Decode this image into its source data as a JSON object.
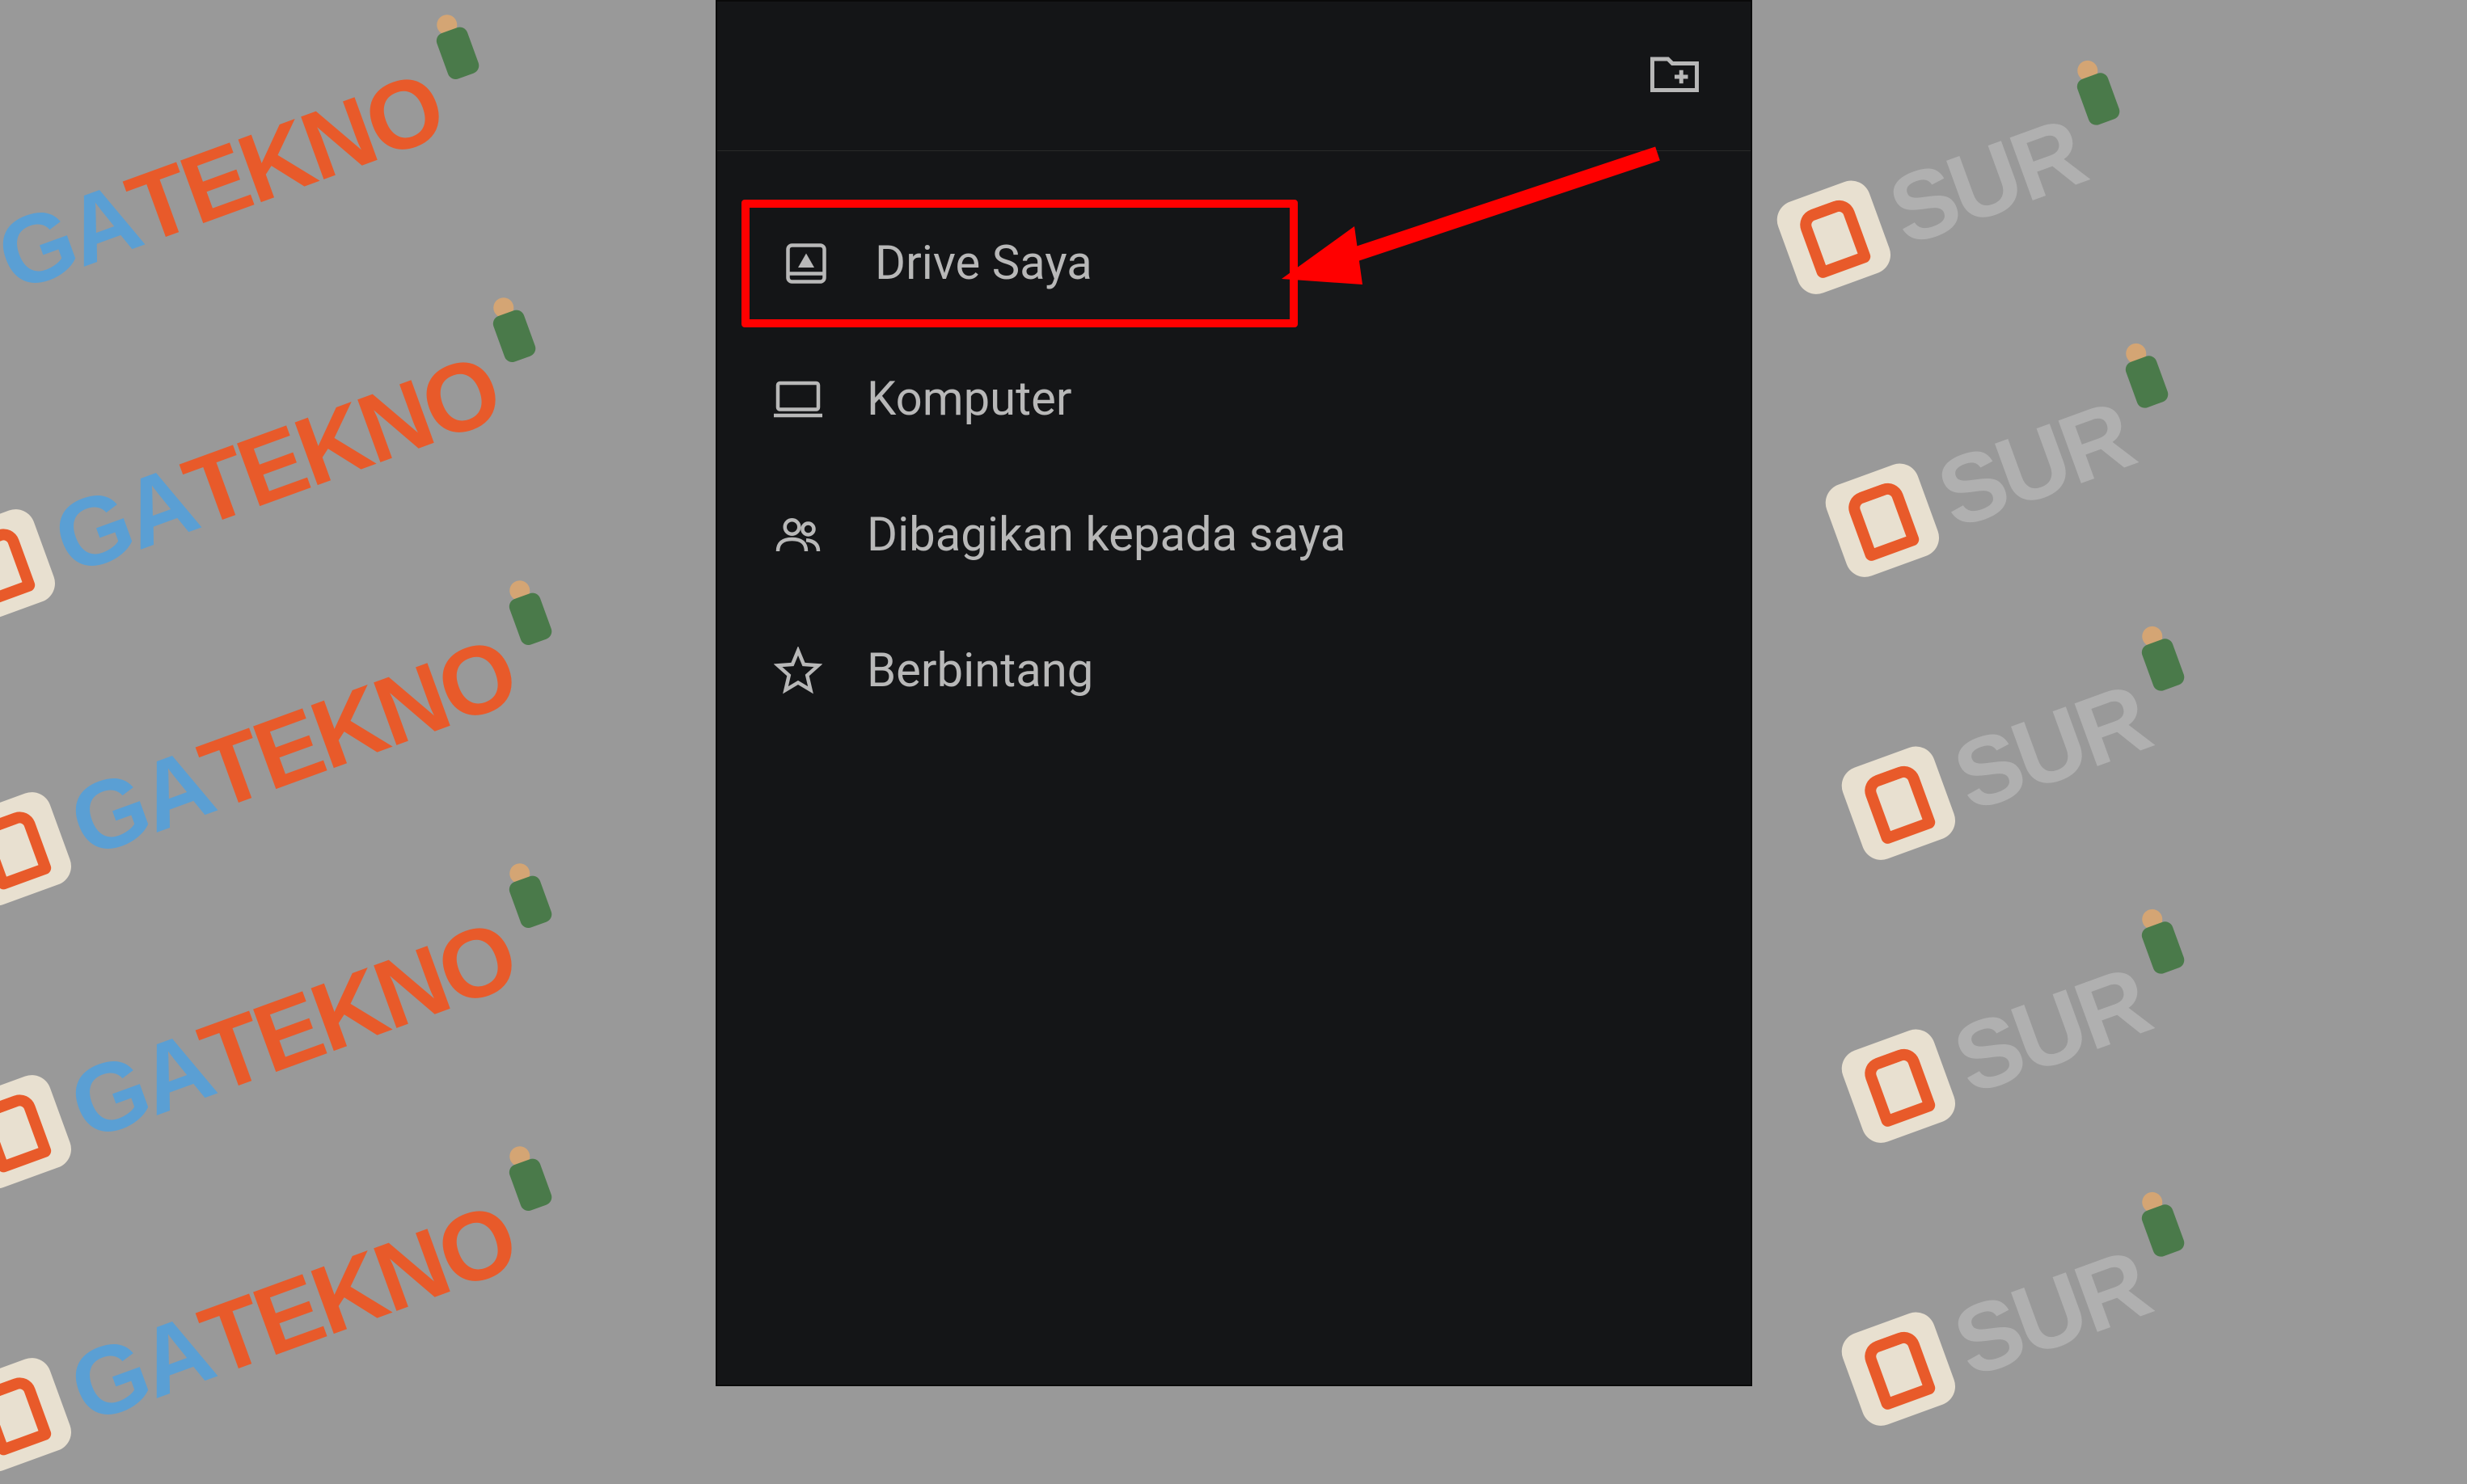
{
  "watermark": {
    "text_part1": "SUR",
    "text_part2": "GA",
    "text_part3": " TEKNO"
  },
  "menu": {
    "items": [
      {
        "label": "Drive Saya",
        "icon": "drive",
        "highlighted": true
      },
      {
        "label": "Komputer",
        "icon": "computer",
        "highlighted": false
      },
      {
        "label": "Dibagikan kepada saya",
        "icon": "shared",
        "highlighted": false
      },
      {
        "label": "Berbintang",
        "icon": "star",
        "highlighted": false
      }
    ]
  },
  "annotations": {
    "arrow_target": "Drive Saya"
  }
}
